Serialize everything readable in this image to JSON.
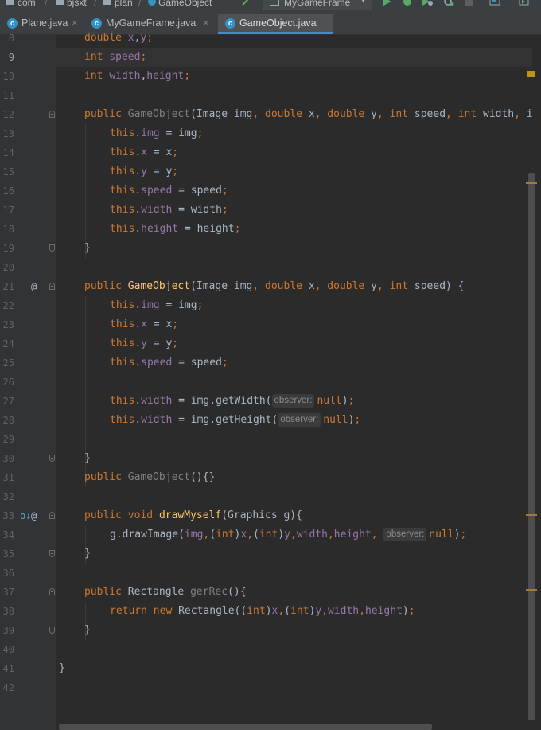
{
  "breadcrumb": {
    "items": [
      "com",
      "bjsxt",
      "plan",
      "GameObject"
    ]
  },
  "toolbar": {
    "run_config": "MyGameFrame"
  },
  "tabs": [
    {
      "label": "Plane.java",
      "active": false
    },
    {
      "label": "MyGameFrame.java",
      "active": false
    },
    {
      "label": "GameObject.java",
      "active": true
    }
  ],
  "editor": {
    "current_line": 9,
    "lines": [
      {
        "n": "8",
        "indent": 1,
        "segs": [
          [
            "kw",
            "double "
          ],
          [
            "fld",
            "x"
          ],
          [
            "txt",
            ","
          ],
          [
            "fld",
            "y"
          ],
          [
            "kw",
            ";"
          ]
        ]
      },
      {
        "n": "9",
        "indent": 1,
        "segs": [
          [
            "kw",
            "int "
          ],
          [
            "fld",
            "speed"
          ],
          [
            "kw",
            ";"
          ]
        ]
      },
      {
        "n": "10",
        "indent": 1,
        "segs": [
          [
            "kw",
            "int "
          ],
          [
            "fld",
            "width"
          ],
          [
            "txt",
            ","
          ],
          [
            "fld",
            "height"
          ],
          [
            "kw",
            ";"
          ]
        ]
      },
      {
        "n": "11",
        "indent": 0,
        "segs": []
      },
      {
        "n": "12",
        "indent": 1,
        "fold": "start",
        "segs": [
          [
            "kw",
            "public "
          ],
          [
            "grey",
            "GameObject"
          ],
          [
            "txt",
            "(Image img"
          ],
          [
            "kw",
            ", "
          ],
          [
            "kw",
            "double "
          ],
          [
            "txt",
            "x"
          ],
          [
            "kw",
            ", "
          ],
          [
            "kw",
            "double "
          ],
          [
            "txt",
            "y"
          ],
          [
            "kw",
            ", "
          ],
          [
            "kw",
            "int "
          ],
          [
            "txt",
            "speed"
          ],
          [
            "kw",
            ", "
          ],
          [
            "kw",
            "int "
          ],
          [
            "txt",
            "width"
          ],
          [
            "kw",
            ", "
          ],
          [
            "txt",
            "i"
          ]
        ]
      },
      {
        "n": "13",
        "indent": 2,
        "segs": [
          [
            "kw",
            "this"
          ],
          [
            "txt",
            "."
          ],
          [
            "fld",
            "img"
          ],
          [
            "txt",
            " = img"
          ],
          [
            "kw",
            ";"
          ]
        ]
      },
      {
        "n": "14",
        "indent": 2,
        "segs": [
          [
            "kw",
            "this"
          ],
          [
            "txt",
            "."
          ],
          [
            "fld",
            "x"
          ],
          [
            "txt",
            " = x"
          ],
          [
            "kw",
            ";"
          ]
        ]
      },
      {
        "n": "15",
        "indent": 2,
        "segs": [
          [
            "kw",
            "this"
          ],
          [
            "txt",
            "."
          ],
          [
            "fld",
            "y"
          ],
          [
            "txt",
            " = y"
          ],
          [
            "kw",
            ";"
          ]
        ]
      },
      {
        "n": "16",
        "indent": 2,
        "segs": [
          [
            "kw",
            "this"
          ],
          [
            "txt",
            "."
          ],
          [
            "fld",
            "speed"
          ],
          [
            "txt",
            " = speed"
          ],
          [
            "kw",
            ";"
          ]
        ]
      },
      {
        "n": "17",
        "indent": 2,
        "segs": [
          [
            "kw",
            "this"
          ],
          [
            "txt",
            "."
          ],
          [
            "fld",
            "width"
          ],
          [
            "txt",
            " = width"
          ],
          [
            "kw",
            ";"
          ]
        ]
      },
      {
        "n": "18",
        "indent": 2,
        "segs": [
          [
            "kw",
            "this"
          ],
          [
            "txt",
            "."
          ],
          [
            "fld",
            "height"
          ],
          [
            "txt",
            " = height"
          ],
          [
            "kw",
            ";"
          ]
        ]
      },
      {
        "n": "19",
        "indent": 1,
        "fold": "end",
        "segs": [
          [
            "txt",
            "}"
          ]
        ]
      },
      {
        "n": "20",
        "indent": 0,
        "segs": []
      },
      {
        "n": "21",
        "indent": 1,
        "fold": "start",
        "at": true,
        "segs": [
          [
            "kw",
            "public "
          ],
          [
            "mdecl",
            "GameObject"
          ],
          [
            "txt",
            "(Image img"
          ],
          [
            "kw",
            ", "
          ],
          [
            "kw",
            "double "
          ],
          [
            "txt",
            "x"
          ],
          [
            "kw",
            ", "
          ],
          [
            "kw",
            "double "
          ],
          [
            "txt",
            "y"
          ],
          [
            "kw",
            ", "
          ],
          [
            "kw",
            "int "
          ],
          [
            "txt",
            "speed) {"
          ]
        ]
      },
      {
        "n": "22",
        "indent": 2,
        "segs": [
          [
            "kw",
            "this"
          ],
          [
            "txt",
            "."
          ],
          [
            "fld",
            "img"
          ],
          [
            "txt",
            " = img"
          ],
          [
            "kw",
            ";"
          ]
        ]
      },
      {
        "n": "23",
        "indent": 2,
        "segs": [
          [
            "kw",
            "this"
          ],
          [
            "txt",
            "."
          ],
          [
            "fld",
            "x"
          ],
          [
            "txt",
            " = x"
          ],
          [
            "kw",
            ";"
          ]
        ]
      },
      {
        "n": "24",
        "indent": 2,
        "segs": [
          [
            "kw",
            "this"
          ],
          [
            "txt",
            "."
          ],
          [
            "fld",
            "y"
          ],
          [
            "txt",
            " = y"
          ],
          [
            "kw",
            ";"
          ]
        ]
      },
      {
        "n": "25",
        "indent": 2,
        "segs": [
          [
            "kw",
            "this"
          ],
          [
            "txt",
            "."
          ],
          [
            "fld",
            "speed"
          ],
          [
            "txt",
            " = speed"
          ],
          [
            "kw",
            ";"
          ]
        ]
      },
      {
        "n": "26",
        "indent": 0,
        "segs": []
      },
      {
        "n": "27",
        "indent": 2,
        "segs": [
          [
            "kw",
            "this"
          ],
          [
            "txt",
            "."
          ],
          [
            "fld",
            "width"
          ],
          [
            "txt",
            " = img.getWidth("
          ],
          [
            "hint",
            "observer:"
          ],
          [
            "kw",
            "null"
          ],
          [
            "txt",
            ")"
          ],
          [
            "kw",
            ";"
          ]
        ]
      },
      {
        "n": "28",
        "indent": 2,
        "segs": [
          [
            "kw",
            "this"
          ],
          [
            "txt",
            "."
          ],
          [
            "fld",
            "width"
          ],
          [
            "txt",
            " = img.getHeight("
          ],
          [
            "hint",
            "observer:"
          ],
          [
            "kw",
            "null"
          ],
          [
            "txt",
            ")"
          ],
          [
            "kw",
            ";"
          ]
        ]
      },
      {
        "n": "29",
        "indent": 0,
        "segs": []
      },
      {
        "n": "30",
        "indent": 1,
        "fold": "end",
        "segs": [
          [
            "txt",
            "}"
          ]
        ]
      },
      {
        "n": "31",
        "indent": 1,
        "segs": [
          [
            "kw",
            "public "
          ],
          [
            "grey",
            "GameObject"
          ],
          [
            "txt",
            "(){}"
          ]
        ]
      },
      {
        "n": "32",
        "indent": 0,
        "segs": []
      },
      {
        "n": "33",
        "indent": 1,
        "fold": "start",
        "at": true,
        "down": true,
        "segs": [
          [
            "kw",
            "public "
          ],
          [
            "kw",
            "void "
          ],
          [
            "mdecl",
            "drawMyself"
          ],
          [
            "txt",
            "(Graphics g){"
          ]
        ]
      },
      {
        "n": "34",
        "indent": 2,
        "segs": [
          [
            "txt",
            "g.drawImage("
          ],
          [
            "fld",
            "img"
          ],
          [
            "kw",
            ","
          ],
          [
            "txt",
            "("
          ],
          [
            "kw",
            "int"
          ],
          [
            "txt",
            ")"
          ],
          [
            "fld",
            "x"
          ],
          [
            "kw",
            ","
          ],
          [
            "txt",
            "("
          ],
          [
            "kw",
            "int"
          ],
          [
            "txt",
            ")"
          ],
          [
            "fld",
            "y"
          ],
          [
            "kw",
            ","
          ],
          [
            "fld",
            "width"
          ],
          [
            "kw",
            ","
          ],
          [
            "fld",
            "height"
          ],
          [
            "kw",
            ", "
          ],
          [
            "hint",
            "observer:"
          ],
          [
            "kw",
            "null"
          ],
          [
            "txt",
            ")"
          ],
          [
            "kw",
            ";"
          ]
        ]
      },
      {
        "n": "35",
        "indent": 1,
        "fold": "end",
        "segs": [
          [
            "txt",
            "}"
          ]
        ]
      },
      {
        "n": "36",
        "indent": 0,
        "segs": []
      },
      {
        "n": "37",
        "indent": 1,
        "fold": "start",
        "segs": [
          [
            "kw",
            "public "
          ],
          [
            "txt",
            "Rectangle "
          ],
          [
            "grey",
            "gerRec"
          ],
          [
            "txt",
            "(){"
          ]
        ]
      },
      {
        "n": "38",
        "indent": 2,
        "segs": [
          [
            "kw",
            "return "
          ],
          [
            "kw",
            "new "
          ],
          [
            "txt",
            "Rectangle(("
          ],
          [
            "kw",
            "int"
          ],
          [
            "txt",
            ")"
          ],
          [
            "fld",
            "x"
          ],
          [
            "kw",
            ","
          ],
          [
            "txt",
            "("
          ],
          [
            "kw",
            "int"
          ],
          [
            "txt",
            ")"
          ],
          [
            "fld",
            "y"
          ],
          [
            "kw",
            ","
          ],
          [
            "fld",
            "width"
          ],
          [
            "kw",
            ","
          ],
          [
            "fld",
            "height"
          ],
          [
            "txt",
            ")"
          ],
          [
            "kw",
            ";"
          ]
        ]
      },
      {
        "n": "39",
        "indent": 1,
        "fold": "end",
        "segs": [
          [
            "txt",
            "}"
          ]
        ]
      },
      {
        "n": "40",
        "indent": 0,
        "segs": []
      },
      {
        "n": "41",
        "indent": 0,
        "segs": [
          [
            "txt",
            "}"
          ]
        ]
      },
      {
        "n": "42",
        "indent": 0,
        "segs": []
      }
    ]
  }
}
